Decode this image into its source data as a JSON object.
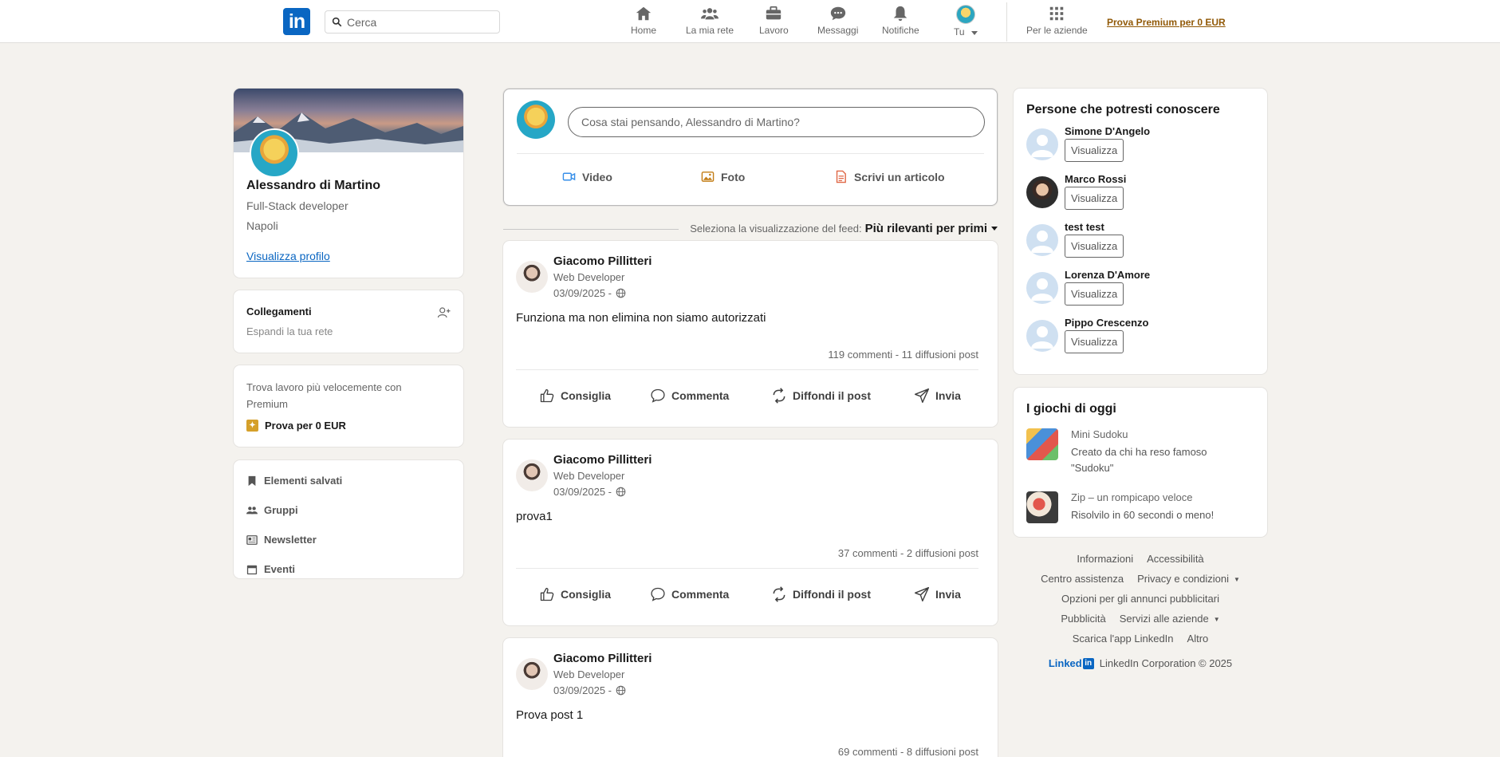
{
  "header": {
    "logo_text": "in",
    "search_placeholder": "Cerca",
    "nav": [
      {
        "label": "Home",
        "icon": "home-icon"
      },
      {
        "label": "La mia rete",
        "icon": "network-icon"
      },
      {
        "label": "Lavoro",
        "icon": "briefcase-icon"
      },
      {
        "label": "Messaggi",
        "icon": "chat-icon"
      },
      {
        "label": "Notifiche",
        "icon": "bell-icon"
      },
      {
        "label": "Tu",
        "icon": "avatar"
      },
      {
        "label": "Per le aziende",
        "icon": "grid-icon"
      }
    ],
    "premium_link": "Prova Premium per 0 EUR"
  },
  "profile": {
    "name": "Alessandro di Martino",
    "headline": "Full-Stack developer",
    "location": "Napoli",
    "view_profile": "Visualizza profilo"
  },
  "connections": {
    "title": "Collegamenti",
    "subtitle": "Espandi la tua rete"
  },
  "premium_card": {
    "text": "Trova lavoro più velocemente con Premium",
    "try_label": "Prova per 0 EUR"
  },
  "shortcuts": [
    {
      "label": "Elementi salvati",
      "icon": "bookmark-icon"
    },
    {
      "label": "Gruppi",
      "icon": "groups-icon"
    },
    {
      "label": "Newsletter",
      "icon": "newsletter-icon"
    },
    {
      "label": "Eventi",
      "icon": "calendar-icon"
    }
  ],
  "composer": {
    "placeholder": "Cosa stai pensando, Alessandro di Martino?",
    "actions": [
      {
        "label": "Video",
        "icon": "video-icon",
        "color": "#378fe9"
      },
      {
        "label": "Foto",
        "icon": "photo-icon",
        "color": "#c37d16"
      },
      {
        "label": "Scrivi un articolo",
        "icon": "article-icon",
        "color": "#e06847"
      }
    ]
  },
  "feed_sort": {
    "label": "Seleziona la visualizzazione del feed:",
    "value": "Più rilevanti per primi"
  },
  "posts": [
    {
      "author": "Giacomo Pillitteri",
      "job": "Web Developer",
      "date": "03/09/2025 -",
      "text": "Funziona ma non elimina non siamo autorizzati",
      "stats": "119 commenti - 11 diffusioni post"
    },
    {
      "author": "Giacomo Pillitteri",
      "job": "Web Developer",
      "date": "03/09/2025 -",
      "text": "prova1",
      "stats": "37 commenti - 2 diffusioni post"
    },
    {
      "author": "Giacomo Pillitteri",
      "job": "Web Developer",
      "date": "03/09/2025 -",
      "text": "Prova post 1",
      "stats": "69 commenti - 8 diffusioni post"
    }
  ],
  "post_actions": [
    "Consiglia",
    "Commenta",
    "Diffondi il post",
    "Invia"
  ],
  "people": {
    "title": "Persone che potresti conoscere",
    "button_label": "Visualizza",
    "items": [
      {
        "name": "Simone D'Angelo",
        "photo": false
      },
      {
        "name": "Marco Rossi",
        "photo": true
      },
      {
        "name": "test test",
        "photo": false
      },
      {
        "name": "Lorenza D'Amore",
        "photo": false
      },
      {
        "name": "Pippo Crescenzo",
        "photo": false
      }
    ]
  },
  "games": {
    "title": "I giochi di oggi",
    "items": [
      {
        "name": "Mini Sudoku",
        "desc": "Creato da chi ha reso famoso \"Sudoku\""
      },
      {
        "name": "Zip – un rompicapo veloce",
        "desc": "Risolvilo in 60 secondi o meno!"
      }
    ]
  },
  "footer": {
    "rows": [
      [
        "Informazioni",
        "Accessibilità"
      ],
      [
        "Centro assistenza",
        "Privacy e condizioni"
      ],
      [
        "Opzioni per gli annunci pubblicitari"
      ],
      [
        "Pubblicità",
        "Servizi alle aziende"
      ],
      [
        "Scarica l'app LinkedIn",
        "Altro"
      ]
    ],
    "brand": "Linked",
    "brand_box": "in",
    "copyright": "LinkedIn Corporation © 2025"
  },
  "colors": {
    "brand": "#0a66c2",
    "premium": "#915907",
    "background": "#f4f2ee"
  }
}
